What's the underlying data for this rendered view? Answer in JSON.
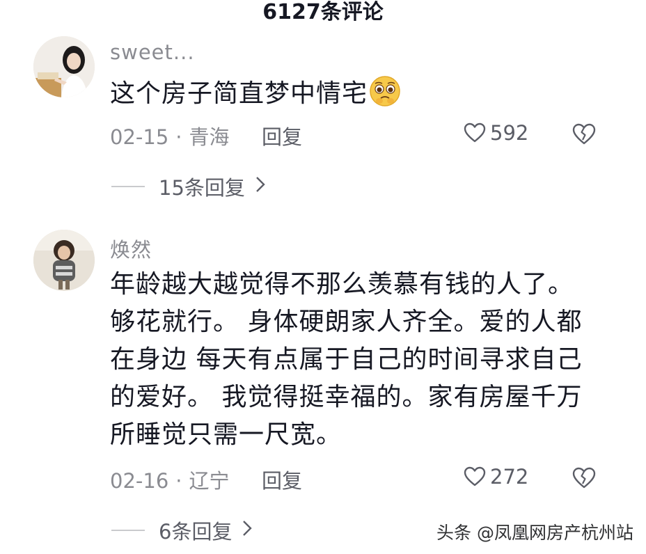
{
  "header": {
    "title": "6127条评论"
  },
  "comments": [
    {
      "username": "sweet...",
      "text": "这个房子简直梦中情宅",
      "emoji": "pleading-face",
      "date": "02-15",
      "location": "青海",
      "reply_label": "回复",
      "likes": "592",
      "replies_label": "15条回复"
    },
    {
      "username": "焕然",
      "text_lines": [
        "年龄越大越觉得不那么羡慕有钱的人了。",
        "够花就行。 身体硬朗家人齐全。爱的人都",
        "在身边 每天有点属于自己的时间寻求自己",
        "的爱好。 我觉得挺幸福的。家有房屋千万",
        "所睡觉只需一尺宽。"
      ],
      "date": "02-16",
      "location": "辽宁",
      "reply_label": "回复",
      "likes": "272",
      "replies_label": "6条回复"
    }
  ],
  "watermark": "头条 @凤凰网房产杭州站",
  "icons": {
    "like": "heart-outline-icon",
    "dislike": "broken-heart-icon",
    "chevron": "chevron-right-icon"
  }
}
